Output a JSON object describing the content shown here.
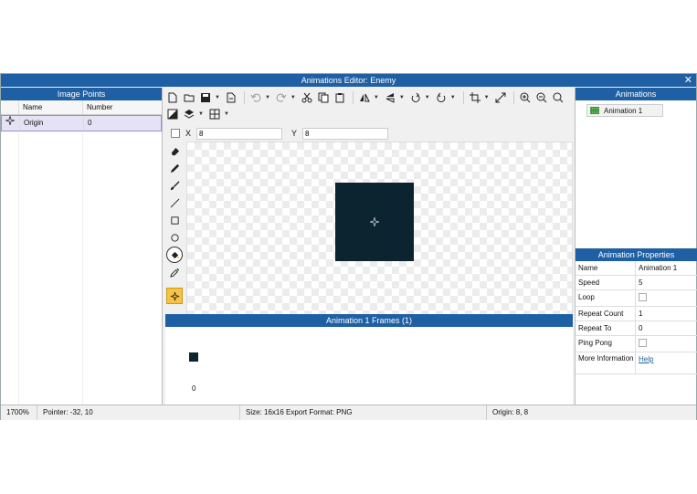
{
  "window": {
    "title": "Animations Editor: Enemy"
  },
  "image_points": {
    "header": "Image Points",
    "columns": {
      "name": "Name",
      "number": "Number"
    },
    "rows": [
      {
        "name": "Origin",
        "number": "0"
      }
    ]
  },
  "coords": {
    "x_label": "X",
    "x_value": "8",
    "y_label": "Y",
    "y_value": "8"
  },
  "toolbar": {
    "icons": [
      "new-file-icon",
      "open-folder-icon",
      "save-icon",
      "export-icon",
      "undo-icon",
      "redo-icon",
      "cut-icon",
      "copy-icon",
      "paste-icon",
      "flip-horizontal-icon",
      "flip-vertical-icon",
      "rotate-left-icon",
      "rotate-right-icon",
      "crop-icon",
      "resize-icon",
      "zoom-in-icon",
      "zoom-out-icon",
      "zoom-fit-icon",
      "color-icon",
      "layers-icon",
      "grid-icon"
    ]
  },
  "tools": [
    "eraser-icon",
    "pencil-icon",
    "brush-icon",
    "line-icon",
    "rectangle-icon",
    "ellipse-icon",
    "fill-bucket-icon",
    "eyedropper-icon",
    "origin-point-icon"
  ],
  "frames": {
    "header": "Animation 1 Frames (1)",
    "items": [
      {
        "number": "0"
      }
    ]
  },
  "animations": {
    "header": "Animations",
    "items": [
      {
        "label": "Animation 1"
      }
    ]
  },
  "properties": {
    "header": "Animation Properties",
    "name_label": "Name",
    "name_value": "Animation 1",
    "speed_label": "Speed",
    "speed_value": "5",
    "loop_label": "Loop",
    "repeat_count_label": "Repeat Count",
    "repeat_count_value": "1",
    "repeat_to_label": "Repeat To",
    "repeat_to_value": "0",
    "ping_pong_label": "Ping Pong",
    "more_info_label": "More Information",
    "help_link": "Help"
  },
  "status": {
    "zoom": "1700%",
    "pointer": "Pointer: -32, 10",
    "size": "Size: 16x16   Export Format: PNG",
    "origin": "Origin: 8, 8"
  },
  "colors": {
    "accent": "#1f5fa4",
    "sprite": "#0c2330",
    "selection": "#e5e2f5",
    "active_tool": "#f6c343"
  }
}
